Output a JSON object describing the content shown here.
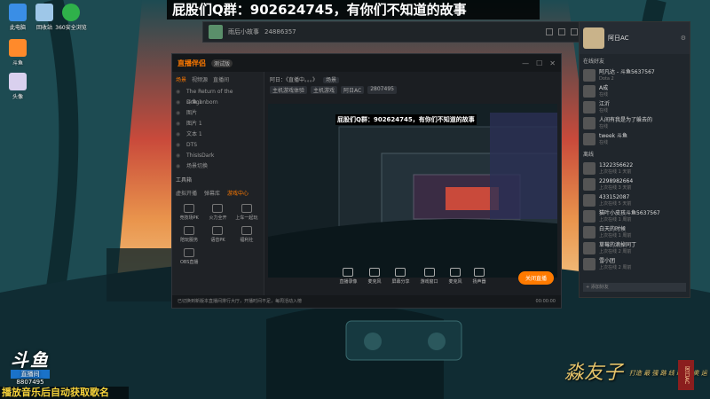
{
  "overlay": {
    "title": "屁股们Q群：902624745，有你们不知道的故事"
  },
  "desktop_icons": [
    {
      "name": "computer-icon",
      "label": "此电脑"
    },
    {
      "name": "recycle-bin-icon",
      "label": "回收站"
    },
    {
      "name": "browser-icon",
      "label": "360安全浏览"
    },
    {
      "name": "app-icon-1",
      "label": "斗鱼"
    },
    {
      "name": "app-icon-2",
      "label": "头像"
    }
  ],
  "room_window": {
    "title": "雨后小故事",
    "room_id": "24886357"
  },
  "friends": {
    "username": "阿日AC",
    "section_online": "在线好友",
    "section_recent": "离线",
    "online": [
      {
        "name": "阿凡达 - 斗鱼5637567",
        "status": "Dota 2"
      },
      {
        "name": "A成",
        "status": "在线"
      },
      {
        "name": "江沂",
        "status": "在线"
      },
      {
        "name": "人间有我是为了躲去的",
        "status": "在线"
      },
      {
        "name": "tweek 斗鱼",
        "status": "在线"
      }
    ],
    "recent": [
      {
        "name": "1322356622",
        "status": "上次在线 1 天前"
      },
      {
        "name": "2298982664",
        "status": "上次在线 3 天前"
      },
      {
        "name": "433152087",
        "status": "上次在线 5 天前"
      },
      {
        "name": "猫叶小皮孩斗鱼5637567",
        "status": "上次在线 1 周前"
      },
      {
        "name": "白天的时候",
        "status": "上次在线 1 周前"
      },
      {
        "name": "草莓的滴掉同丁",
        "status": "上次在线 2 周前"
      },
      {
        "name": "雪小团",
        "status": "上次在线 2 周前"
      }
    ],
    "search_placeholder": "+ 添加好友"
  },
  "studio": {
    "logo": "直播伴侣",
    "beta": "测试版",
    "broadcaster": "阿日：《直播中。。。》",
    "tag": "场景",
    "tags": [
      "主机游戏体验",
      "主机游戏",
      "阿日AC",
      "2807495"
    ],
    "scene_tabs": [
      "场景",
      "视频源",
      "直播间"
    ],
    "scenes": [
      "The Return of the Dragonborn",
      "斗鱼 1",
      "图片",
      "图片 1",
      "文本 1",
      "DTS",
      "ThisIsDark",
      "场景切换"
    ],
    "tool_header": "工具箱",
    "tool_tabs": [
      "虚拟开播",
      "弹幕库",
      "游戏中心"
    ],
    "tools": [
      "竞技场PK",
      "火力全开",
      "上车一起玩",
      "陪玩服务",
      "语音PK",
      "福利社",
      "OBS直播"
    ],
    "preview_text": "屁股们Q群：902624745，有你们不知道的故事",
    "bottom_tools": [
      "直播录像",
      "麦克风",
      "屏幕分享",
      "游戏窗口",
      "麦克风",
      "扬声器"
    ],
    "go_live": "关闭直播",
    "status": "已切换到新版本直播间排行大厅，开播时间不足，每周活动入榜",
    "clock": "00:00:00"
  },
  "bottom_logo": {
    "brand": "斗鱼",
    "subtitle": "直播间",
    "room_number": "8807495"
  },
  "ticker": "播放音乐后自动获取歌名",
  "signature": {
    "main": "淼友子",
    "tagline": "打造 最 强 路 线 联 机 奥 运",
    "seal": "阿日AC"
  },
  "colors": {
    "accent": "#ff7a00",
    "wallpaper_teal": "#1d4b52",
    "sunset_red": "#c94a3b",
    "sunset_orange": "#e9944c"
  }
}
